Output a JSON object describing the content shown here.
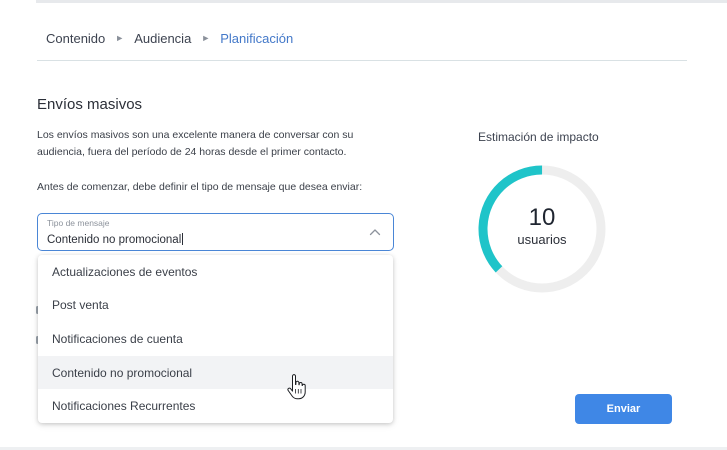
{
  "breadcrumb": {
    "items": [
      "Contenido",
      "Audiencia",
      "Planificación"
    ],
    "separator": "►"
  },
  "section": {
    "title": "Envíos masivos",
    "description_line1": "Los envíos masivos son una excelente manera de conversar con su",
    "description_line2": "audiencia, fuera del período de 24 horas desde el primer contacto.",
    "instruction": "Antes de comenzar, debe definir el tipo de mensaje que desea enviar:"
  },
  "select": {
    "label": "Tipo de mensaje",
    "value": "Contenido no promocional",
    "icon": "chevron-up-icon"
  },
  "dropdown": {
    "options": [
      "Actualizaciones de eventos",
      "Post venta",
      "Notificaciones de cuenta",
      "Contenido no promocional",
      "Notificaciones Recurrentes"
    ],
    "hovered": "Contenido no promocional"
  },
  "impact": {
    "title": "Estimación de impacto",
    "value": "10",
    "unit": "usuarios",
    "fill_fraction": 0.37
  },
  "actions": {
    "send_label": "Enviar"
  },
  "colors": {
    "accent": "#3f87e6",
    "link": "#4479c9",
    "gauge_fill": "#1fc4c9",
    "gauge_track": "#eeeeee"
  }
}
